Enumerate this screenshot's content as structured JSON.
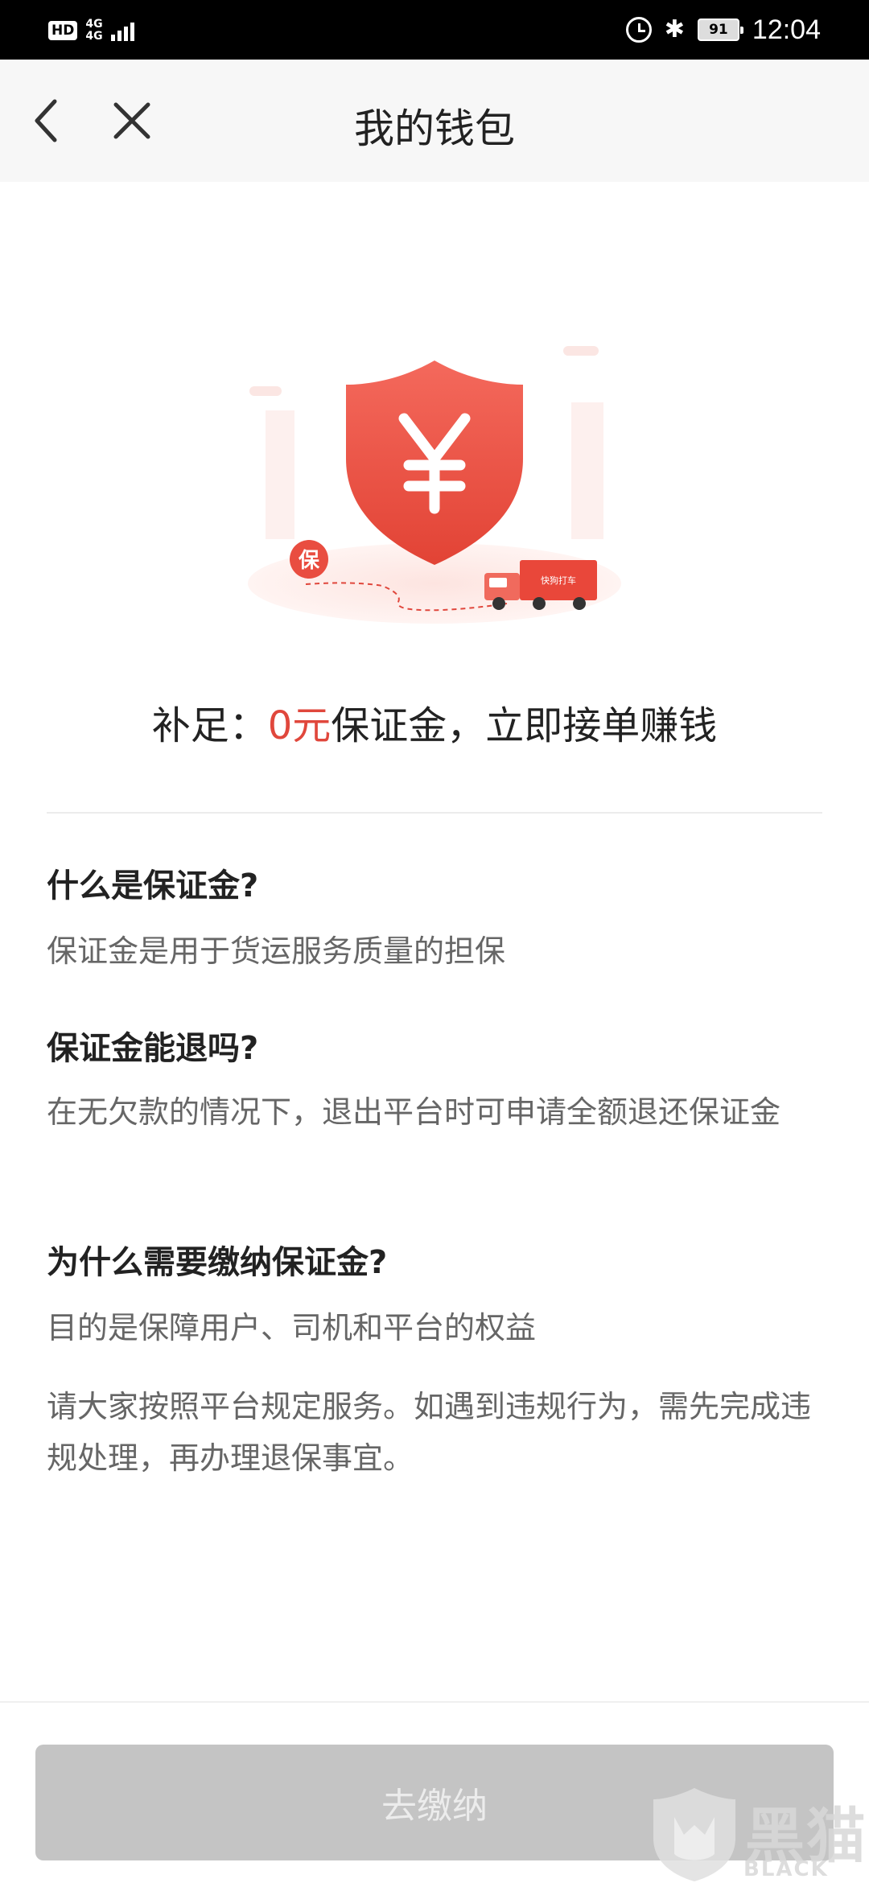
{
  "status_bar": {
    "hd": "HD",
    "net_top": "4G",
    "net_bottom": "4G",
    "battery": "91",
    "time": "12:04",
    "bluetooth": "✱"
  },
  "header": {
    "title": "我的钱包",
    "back_icon": "chevron-left-icon",
    "close_icon": "close-icon"
  },
  "hero": {
    "shield_symbol": "¥",
    "badge": "保",
    "truck_label": "快狗打车",
    "shield_color": "#f0584a",
    "accent_color": "#e0473c"
  },
  "promo": {
    "prefix": "补足：",
    "amount": "0元",
    "suffix": "保证金，立即接单赚钱"
  },
  "faq": [
    {
      "question": "什么是保证金?",
      "answers": [
        "保证金是用于货运服务质量的担保"
      ]
    },
    {
      "question": "保证金能退吗?",
      "answers": [
        "在无欠款的情况下，退出平台时可申请全额退还保证金"
      ]
    },
    {
      "question": "为什么需要缴纳保证金?",
      "answers": [
        "目的是保障用户、司机和平台的权益",
        "请大家按照平台规定服务。如遇到违规行为，需先完成违规处理，再办理退保事宜。"
      ]
    }
  ],
  "button": {
    "label": "去缴纳",
    "color": "#c4c4c4"
  },
  "watermark": {
    "text": "黑猫",
    "sub": "BLACK CAT"
  }
}
